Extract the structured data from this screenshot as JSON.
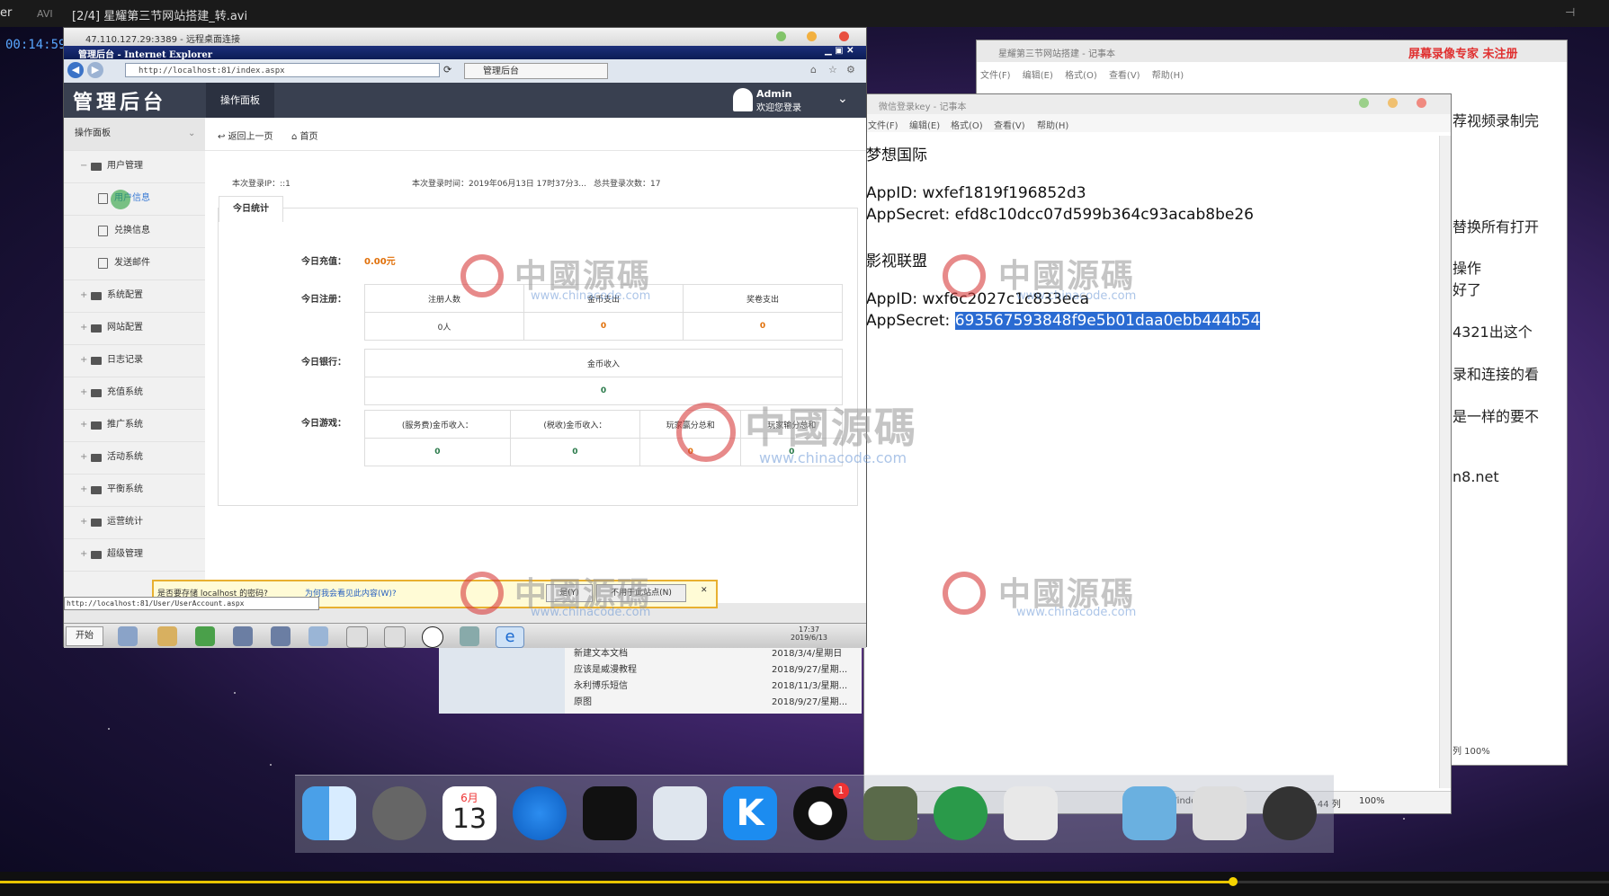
{
  "player": {
    "menu_label": "er",
    "format": "AVI",
    "title": "[2/4] 星耀第三节网站搭建_转.avi",
    "timecode": "00:14:59"
  },
  "rdp": {
    "title": "47.110.127.29:3389 - 远程桌面连接"
  },
  "ie": {
    "title": "管理后台 - Internet Explorer",
    "url": "http://localhost:81/index.aspx",
    "tab_label": "管理后台",
    "status_url": "http://localhost:81/User/UserAccount.aspx"
  },
  "admin": {
    "logo": "管理后台",
    "nav_dashboard": "操作面板",
    "user_name": "Admin",
    "user_greeting": "欢迎您登录",
    "sidebar_header": "操作面板",
    "sidebar": [
      {
        "label": "用户管理",
        "sign": "−"
      },
      {
        "label": "用户信息",
        "sign": ""
      },
      {
        "label": "兑换信息",
        "sign": ""
      },
      {
        "label": "发送邮件",
        "sign": ""
      },
      {
        "label": "系统配置",
        "sign": "+"
      },
      {
        "label": "网站配置",
        "sign": "+"
      },
      {
        "label": "日志记录",
        "sign": "+"
      },
      {
        "label": "充值系统",
        "sign": "+"
      },
      {
        "label": "推广系统",
        "sign": "+"
      },
      {
        "label": "活动系统",
        "sign": "+"
      },
      {
        "label": "平衡系统",
        "sign": "+"
      },
      {
        "label": "运营统计",
        "sign": "+"
      },
      {
        "label": "超级管理",
        "sign": "+"
      }
    ],
    "crumb_back": "返回上一页",
    "crumb_home": "首页",
    "login_ip": "本次登录IP：::1",
    "login_time": "本次登录时间：2019年06月13日 17时37分3...",
    "login_count": "总共登录次数：17",
    "stats_tab": "今日统计",
    "recharge_label": "今日充值：",
    "recharge_value": "0.00元",
    "register_label": "今日注册：",
    "register_headers": [
      "注册人数",
      "金币支出",
      "奖卷支出"
    ],
    "register_values": [
      "0人",
      "0",
      "0"
    ],
    "bank_label": "今日银行：",
    "bank_header": "金币收入",
    "bank_value": "0",
    "game_label": "今日游戏：",
    "game_headers": [
      "(服务费)金币收入：",
      "(税收)金币收入：",
      "玩家赢分总和",
      "玩家输分总和"
    ],
    "game_values": [
      "0",
      "0",
      "0",
      "0"
    ]
  },
  "autocomplete": {
    "question": "是否要存储 localhost 的密码?",
    "why_link": "为何我会看见此内容(W)?",
    "yes": "是(Y)",
    "never": "不用于此站点(N)"
  },
  "xp": {
    "start": "开始",
    "clock_time": "17:37",
    "clock_date": "2019/6/13"
  },
  "explorer": {
    "rows": [
      {
        "name": "新建文本文档",
        "date": "2018/3/4/星期日"
      },
      {
        "name": "应该是威漫教程",
        "date": "2018/9/27/星期..."
      },
      {
        "name": "永利博乐短信",
        "date": "2018/11/3/星期..."
      },
      {
        "name": "原图",
        "date": "2018/9/27/星期..."
      }
    ]
  },
  "notepad_back": {
    "title": "星耀第三节网站搭建 - 记事本",
    "recorder_tag": "屏幕录像专家 未注册",
    "menu": [
      "文件(F)",
      "编辑(E)",
      "格式(O)",
      "查看(V)",
      "帮助(H)"
    ],
    "lines": [
      "荐视频录制完",
      "替换所有打开",
      "操作",
      "好了",
      "4321出这个",
      "录和连接的看",
      "是一样的要不",
      "n8.net"
    ],
    "status_col": "列 100%"
  },
  "notepad_front": {
    "title": "微信登录key - 记事本",
    "menu": [
      "文件(F)",
      "编辑(E)",
      "格式(O)",
      "查看(V)",
      "帮助(H)"
    ],
    "lines": [
      {
        "text": "梦想国际",
        "selected": ""
      },
      {
        "text": "",
        "selected": ""
      },
      {
        "text": "AppID: wxfef1819f196852d3",
        "selected": ""
      },
      {
        "text": "AppSecret: efd8c10dcc07d599b364c93acab8be26",
        "selected": ""
      },
      {
        "text": "",
        "selected": ""
      },
      {
        "text": "影视联盟",
        "selected": ""
      },
      {
        "text": "",
        "selected": ""
      },
      {
        "text": "AppID: wxf6c2027c1c833eca",
        "selected": ""
      },
      {
        "text": "AppSecret: ",
        "selected": "693567593848f9e5b01daa0ebb444b54"
      }
    ],
    "status_encoding": "Windows (CRLF)",
    "status_position": "第 9 行，第 44 列",
    "status_zoom": "100%"
  },
  "watermark": {
    "text": "中國源碼",
    "url": "www.chinacode.com"
  },
  "dock": {
    "calendar_month": "6月",
    "calendar_day": "13",
    "qq_badge": "1"
  },
  "colors": {
    "admin_header": "#394050",
    "accent_orange": "#e0700a",
    "selection": "#2a6bd2"
  }
}
